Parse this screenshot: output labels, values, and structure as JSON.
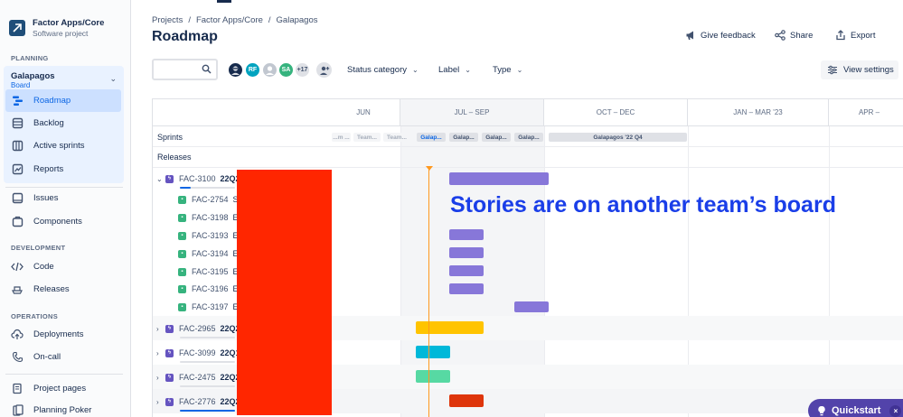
{
  "project": {
    "name": "Factor Apps/Core",
    "type": "Software project"
  },
  "sidebar": {
    "planning_title": "PLANNING",
    "board": {
      "name": "Galapagos",
      "sub": "Board"
    },
    "planning_items": [
      {
        "label": "Roadmap",
        "icon": "roadmap-icon"
      },
      {
        "label": "Backlog",
        "icon": "backlog-icon"
      },
      {
        "label": "Active sprints",
        "icon": "board-columns-icon"
      },
      {
        "label": "Reports",
        "icon": "chart-icon"
      }
    ],
    "other_items": [
      {
        "label": "Issues",
        "icon": "issues-icon"
      },
      {
        "label": "Components",
        "icon": "components-icon"
      }
    ],
    "development_title": "DEVELOPMENT",
    "development_items": [
      {
        "label": "Code",
        "icon": "code-icon"
      },
      {
        "label": "Releases",
        "icon": "ship-icon"
      }
    ],
    "operations_title": "OPERATIONS",
    "operations_items": [
      {
        "label": "Deployments",
        "icon": "cloud-icon"
      },
      {
        "label": "On-call",
        "icon": "phone-icon"
      }
    ],
    "bottom_items": [
      {
        "label": "Project pages",
        "icon": "page-icon"
      },
      {
        "label": "Planning Poker",
        "icon": "poker-icon"
      }
    ]
  },
  "header": {
    "breadcrumbs": [
      "Projects",
      "/",
      "Factor Apps/Core",
      "/",
      "Galapagos"
    ],
    "title": "Roadmap",
    "actions": {
      "feedback": "Give feedback",
      "share": "Share",
      "export": "Export"
    }
  },
  "filters": {
    "avatars": [
      {
        "initials": "",
        "color": "#172b4d"
      },
      {
        "initials": "RF",
        "color": "#00a3bf"
      },
      {
        "initials": "",
        "color": "#c1c7d0"
      },
      {
        "initials": "SA",
        "color": "#36b37e"
      },
      {
        "initials": "+17",
        "color": "#dfe1e6"
      }
    ],
    "status": "Status category",
    "label": "Label",
    "type": "Type",
    "view_settings": "View settings"
  },
  "roadmap": {
    "quarters": [
      "JUN",
      "JUL – SEP",
      "OCT – DEC",
      "JAN – MAR '23",
      "APR –"
    ],
    "sprints_label": "Sprints",
    "releases_label": "Releases",
    "sprints": [
      {
        "label": "...m ...",
        "kind": "past"
      },
      {
        "label": "Team...",
        "kind": "past"
      },
      {
        "label": "Team...",
        "kind": "past"
      },
      {
        "label": "Galap...",
        "kind": "cur"
      },
      {
        "label": "Galap...",
        "kind": "fut"
      },
      {
        "label": "Galap...",
        "kind": "fut"
      },
      {
        "label": "Galap...",
        "kind": "fut"
      },
      {
        "label": "Galapagos '22 Q4",
        "kind": "fut"
      }
    ],
    "items": [
      {
        "key": "FAC-3100",
        "summary": "22Q2",
        "type": "epic",
        "expand": "⌄",
        "progress": 0.2
      },
      {
        "key": "FAC-2754",
        "summary": "S",
        "type": "story"
      },
      {
        "key": "FAC-3198",
        "summary": "E",
        "type": "story"
      },
      {
        "key": "FAC-3193",
        "summary": "E",
        "type": "story"
      },
      {
        "key": "FAC-3194",
        "summary": "E",
        "type": "story"
      },
      {
        "key": "FAC-3195",
        "summary": "E",
        "type": "story"
      },
      {
        "key": "FAC-3196",
        "summary": "E",
        "type": "story"
      },
      {
        "key": "FAC-3197",
        "summary": "E",
        "type": "story"
      },
      {
        "key": "FAC-2965",
        "summary": "22Q2",
        "type": "epic",
        "expand": "›",
        "progress": 0
      },
      {
        "key": "FAC-3099",
        "summary": "22Q1",
        "type": "epic",
        "expand": "›",
        "progress": 0
      },
      {
        "key": "FAC-2475",
        "summary": "22Q2",
        "type": "epic",
        "expand": "›",
        "progress": 0
      },
      {
        "key": "FAC-2776",
        "summary": "22Q2",
        "type": "epic",
        "expand": "›",
        "progress": 1.0
      }
    ],
    "bar_colors": {
      "purple": "#8777d9",
      "yellow": "#ffc400",
      "cyan": "#00b8d9",
      "green": "#57d9a3",
      "red": "#de350b"
    }
  },
  "annotation": "Stories are on another team’s board",
  "quickstart": {
    "label": "Quickstart",
    "close": "×"
  }
}
